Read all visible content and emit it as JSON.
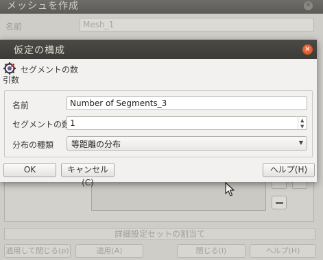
{
  "background_window": {
    "title": "メッシュを作成",
    "name_label": "名前",
    "name_value": "Mesh_1",
    "assign_button": "詳細設定セットの割当て",
    "buttons": {
      "apply_close": "適用して閉じる(p)",
      "apply": "適用(A)",
      "close": "閉じる(l)",
      "help": "ヘルプ(H)"
    }
  },
  "dialog": {
    "title": "仮定の構成",
    "hypothesis_type": "セグメントの数",
    "arguments_label": "引数",
    "fields": {
      "name_label": "名前",
      "name_value": "Number of Segments_3",
      "segments_label": "セグメントの数",
      "segments_value": "1",
      "distribution_label": "分布の種類",
      "distribution_value": "等距離の分布"
    },
    "buttons": {
      "ok": "OK",
      "cancel": "キャンセル(C)",
      "help": "ヘルプ(H)"
    }
  },
  "icons": {
    "close": "close-icon",
    "hypothesis": "hypothesis-icon",
    "dropdown": "chevron-down-icon",
    "spin": "spin-arrows-icon",
    "cursor": "mouse-pointer-icon"
  },
  "colors": {
    "dialog_titlebar": "#3c3b37",
    "close_button": "#e05a2a",
    "dialog_bg": "#f2f1f0"
  }
}
